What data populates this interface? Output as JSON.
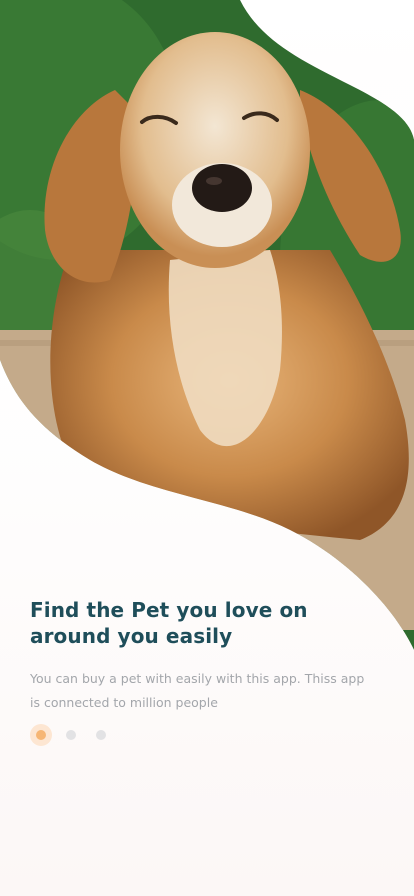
{
  "onboarding": {
    "headline": "Find the Pet you love on\naround you easily",
    "description": "You can buy a pet with easily with this app. Thiss app\nis connected to million people",
    "pager": {
      "total_pages": 3,
      "active_index": 0
    }
  },
  "hero_image": {
    "subject": "golden-retriever-dog-photo"
  },
  "colors": {
    "headline": "#1f4e5a",
    "description": "#a3a6ab",
    "dot_active": "#f6b675",
    "dot_inactive": "#e2e2e4",
    "background": "#ffffff"
  }
}
